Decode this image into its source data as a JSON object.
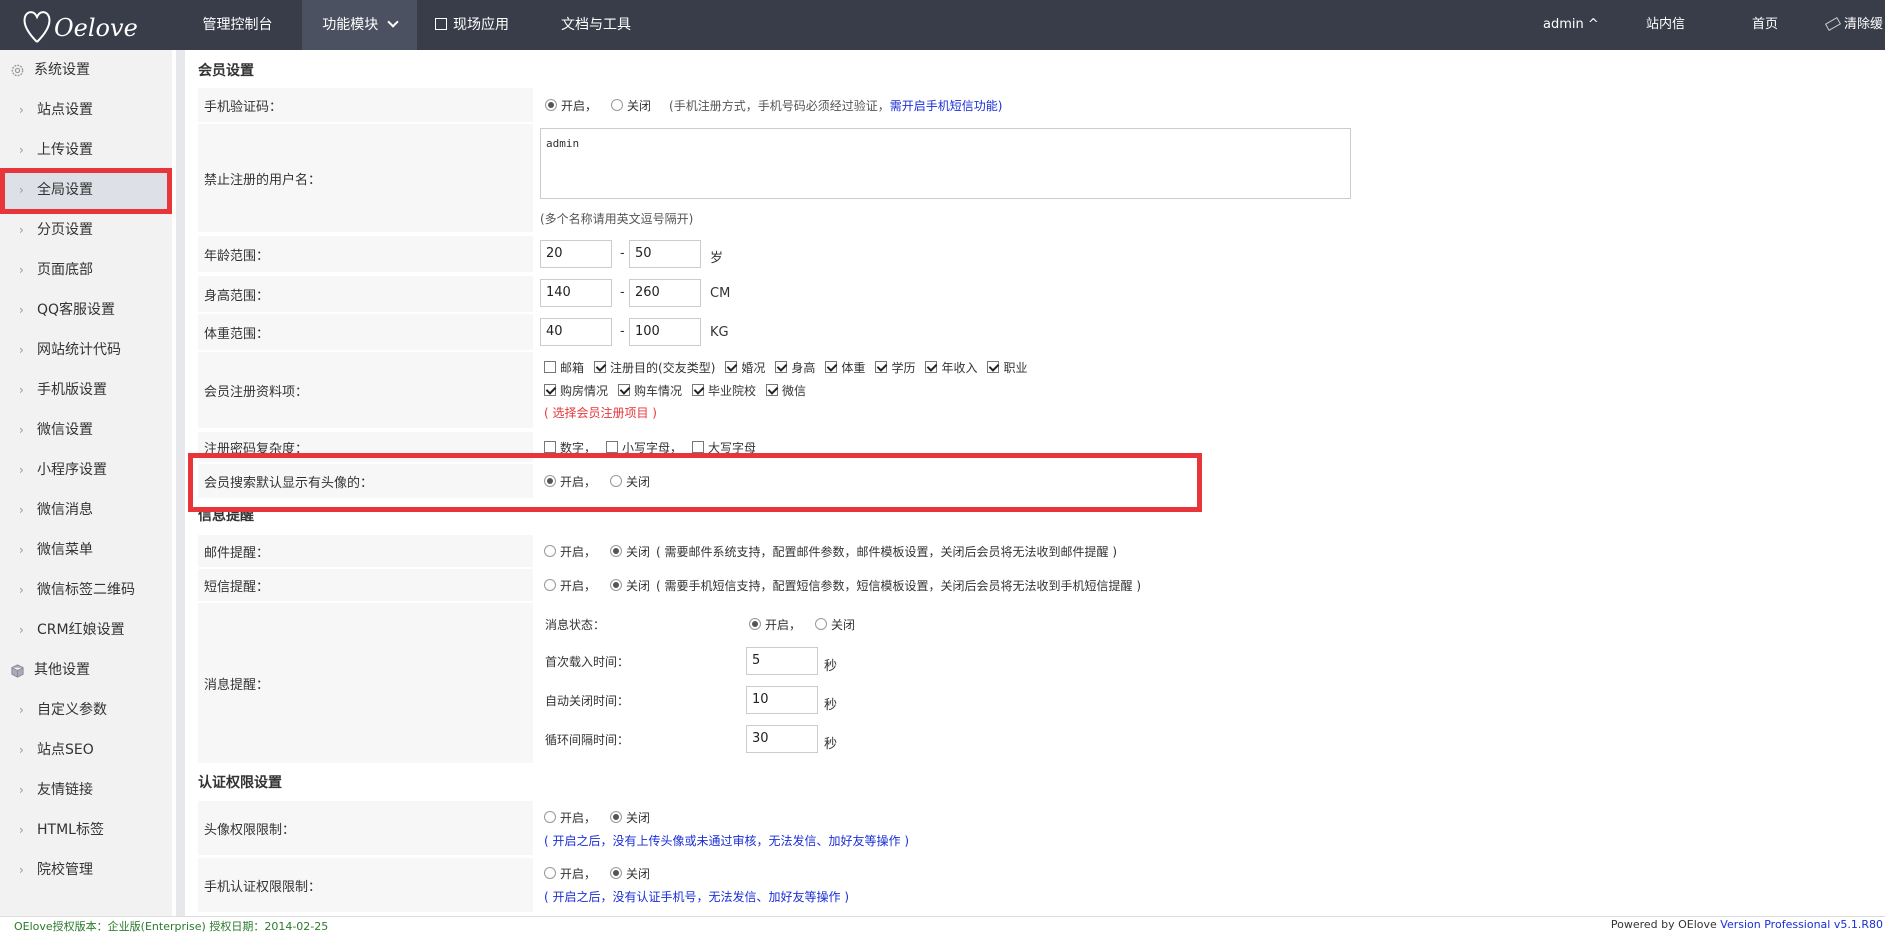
{
  "logo_text": "Oelove",
  "nav": {
    "dashboard": "管理控制台",
    "modules": "功能模块",
    "scene": "现场应用",
    "docs": "文档与工具"
  },
  "right_nav": {
    "user": "admin ^",
    "messages": "站内信",
    "home": "首页",
    "clear": "清除缓"
  },
  "sidebar": {
    "group1": "系统设置",
    "items1": [
      "站点设置",
      "上传设置",
      "全局设置",
      "分页设置",
      "页面底部",
      "QQ客服设置",
      "网站统计代码",
      "手机版设置",
      "微信设置",
      "小程序设置",
      "微信消息",
      "微信菜单",
      "微信标签二维码",
      "CRM红娘设置"
    ],
    "group2": "其他设置",
    "items2": [
      "自定义参数",
      "站点SEO",
      "友情链接",
      "HTML标签",
      "院校管理"
    ]
  },
  "member": {
    "title": "会员设置",
    "phone_code_label": "手机验证码：",
    "on": "开启，",
    "off": "关闭",
    "phone_note": "(手机注册方式，手机号码必须经过验证，",
    "phone_link": "需开启手机短信功能)",
    "banned_label": "禁止注册的用户名：",
    "banned_value": "admin",
    "banned_note": "(多个名称请用英文逗号隔开)",
    "age_label": "年龄范围：",
    "age_min": "20",
    "age_max": "50",
    "age_unit": "岁",
    "height_label": "身高范围：",
    "height_min": "140",
    "height_max": "260",
    "height_unit": "CM",
    "weight_label": "体重范围：",
    "weight_min": "40",
    "weight_max": "100",
    "weight_unit": "KG",
    "dash": "-",
    "reg_label": "会员注册资料项：",
    "reg_items_row1": [
      "邮箱",
      "注册目的(交友类型)",
      "婚况",
      "身高",
      "体重",
      "学历",
      "年收入",
      "职业"
    ],
    "reg_items_row2": [
      "购房情况",
      "购车情况",
      "毕业院校",
      "微信"
    ],
    "reg_note": "( 选择会员注册项目 )",
    "pwd_label": "注册密码复杂度：",
    "pwd_opts": [
      "数字，",
      "小写字母，",
      "大写字母"
    ],
    "avatar_label": "会员搜索默认显示有头像的：",
    "avatar_on": "开启，",
    "avatar_off": "关闭"
  },
  "notify": {
    "title": "信息提醒",
    "mail_label": "邮件提醒：",
    "mail_note": "( 需要邮件系统支持，配置邮件参数，邮件模板设置，关闭后会员将无法收到邮件提醒 )",
    "sms_label": "短信提醒：",
    "sms_note": "( 需要手机短信支持，配置短信参数，短信模板设置，关闭后会员将无法收到手机短信提醒 )",
    "msg_label": "消息提醒：",
    "msg_state": "消息状态：",
    "first_load": "首次载入时间：",
    "first_load_val": "5",
    "auto_close": "自动关闭时间：",
    "auto_close_val": "10",
    "loop": "循环间隔时间：",
    "loop_val": "30",
    "sec": "秒"
  },
  "auth": {
    "title": "认证权限设置",
    "avatar_label": "头像权限限制：",
    "avatar_note": "( 开启之后，没有上传头像或未通过审核，无法发信、加好友等操作 )",
    "phone_label": "手机认证权限限制：",
    "phone_note": "( 开启之后，没有认证手机号，无法发信、加好友等操作 )"
  },
  "footer": {
    "left": "OElove授权版本：企业版(Enterprise) 授权日期：2014-02-25",
    "right_prefix": "Powered by OElove ",
    "right_link": "Version Professional v5.1.R80"
  }
}
